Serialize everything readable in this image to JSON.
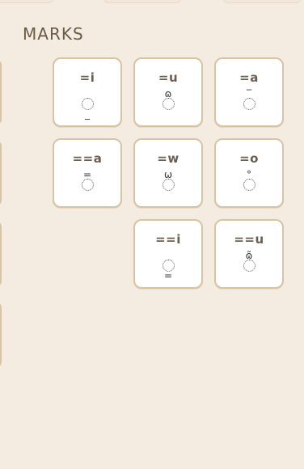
{
  "section": {
    "title": "MARKS"
  },
  "marks": [
    {
      "label": "=i",
      "glyph": "◌̱",
      "mark": "_",
      "position": "below"
    },
    {
      "label": "=u",
      "glyph": "◌̫̇",
      "mark": "ɷ",
      "position": "above"
    },
    {
      "label": "=a",
      "glyph": "◌̄",
      "mark": "‾",
      "position": "above"
    },
    {
      "label": "==a",
      "glyph": "◌̿",
      "mark": "=",
      "position": "above"
    },
    {
      "label": "=w",
      "glyph": "◌̫",
      "mark": "ω",
      "position": "above"
    },
    {
      "label": "=o",
      "glyph": "◌̊",
      "mark": "°",
      "position": "above"
    },
    {
      "label": "==i",
      "glyph": "◌̳",
      "mark": "=",
      "position": "below"
    },
    {
      "label": "==u",
      "glyph": "◌̫̃",
      "mark": "ɷ̃",
      "position": "above"
    }
  ]
}
